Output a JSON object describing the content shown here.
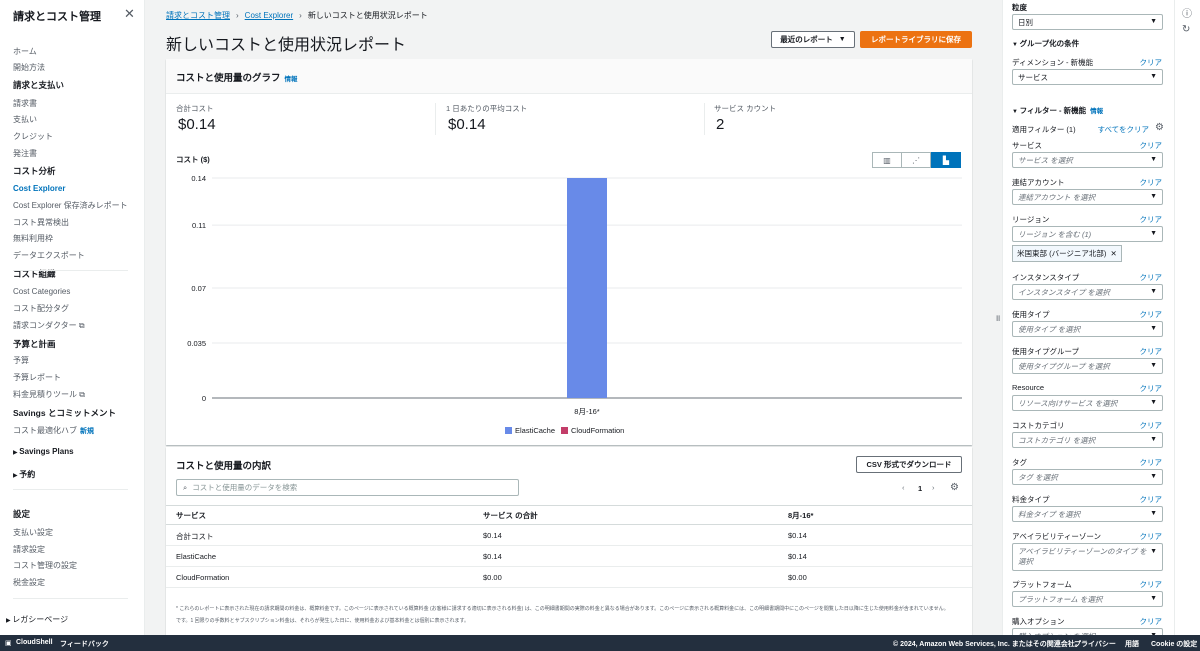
{
  "sidebar": {
    "title": "請求とコスト管理",
    "items": [
      {
        "label": "ホーム",
        "kind": "item"
      },
      {
        "label": "開始方法",
        "kind": "item"
      },
      {
        "label": "請求と支払い",
        "kind": "head"
      },
      {
        "label": "請求書",
        "kind": "item"
      },
      {
        "label": "支払い",
        "kind": "item"
      },
      {
        "label": "クレジット",
        "kind": "item"
      },
      {
        "label": "発注書",
        "kind": "item"
      },
      {
        "label": "コスト分析",
        "kind": "head"
      },
      {
        "label": "Cost Explorer",
        "kind": "active"
      },
      {
        "label": "Cost Explorer 保存済みレポート",
        "kind": "item"
      },
      {
        "label": "コスト異常検出",
        "kind": "item"
      },
      {
        "label": "無料利用枠",
        "kind": "item"
      },
      {
        "label": "データエクスポート",
        "kind": "item"
      },
      {
        "label": "コスト組織",
        "kind": "head"
      },
      {
        "label": "Cost Categories",
        "kind": "item"
      },
      {
        "label": "コスト配分タグ",
        "kind": "item"
      },
      {
        "label": "請求コンダクター",
        "kind": "item",
        "external": true
      },
      {
        "label": "予算と計画",
        "kind": "head"
      },
      {
        "label": "予算",
        "kind": "item"
      },
      {
        "label": "予算レポート",
        "kind": "item"
      },
      {
        "label": "料金見積りツール",
        "kind": "item",
        "external": true
      },
      {
        "label": "Savings とコミットメント",
        "kind": "head"
      },
      {
        "label": "コスト最適化ハブ",
        "kind": "item",
        "badge": "新規"
      },
      {
        "label": "Savings Plans",
        "kind": "group"
      },
      {
        "label": "予約",
        "kind": "group"
      },
      {
        "label": "設定",
        "kind": "head"
      },
      {
        "label": "支払い設定",
        "kind": "item"
      },
      {
        "label": "請求設定",
        "kind": "item"
      },
      {
        "label": "コスト管理の設定",
        "kind": "item"
      },
      {
        "label": "税金設定",
        "kind": "item"
      },
      {
        "label": "レガシーページ",
        "kind": "legacy"
      }
    ]
  },
  "breadcrumb": [
    "請求とコスト管理",
    "Cost Explorer",
    "新しいコストと使用状況レポート"
  ],
  "page_title": "新しいコストと使用状況レポート",
  "buttons": {
    "recent": "最近のレポート",
    "save": "レポートライブラリに保存",
    "csv": "CSV 形式でダウンロード"
  },
  "graph_panel": {
    "title": "コストと使用量のグラフ",
    "info": "情報",
    "kpis": [
      {
        "label": "合計コスト",
        "value": "$0.14"
      },
      {
        "label": "1 日あたりの平均コスト",
        "value": "$0.14"
      },
      {
        "label": "サービス カウント",
        "value": "2"
      }
    ]
  },
  "chart_data": {
    "type": "bar",
    "ylabel": "コスト ($)",
    "categories": [
      "8月-16*"
    ],
    "series": [
      {
        "name": "ElastiCache",
        "values": [
          0.14
        ],
        "color": "#688ae8"
      },
      {
        "name": "CloudFormation",
        "values": [
          0.0
        ],
        "color": "#c33d69"
      }
    ],
    "ylim": [
      0,
      0.14
    ],
    "yticks": [
      "0",
      "0.035",
      "0.07",
      "0.11",
      "0.14"
    ],
    "grid": true,
    "legend": "bottom"
  },
  "breakdown": {
    "title": "コストと使用量の内訳",
    "search_placeholder": "コストと使用量のデータを検索",
    "page": "1",
    "columns": [
      "サービス",
      "サービス の合計",
      "8月-16*"
    ],
    "rows": [
      [
        "合計コスト",
        "$0.14",
        "$0.14"
      ],
      [
        "ElastiCache",
        "$0.14",
        "$0.14"
      ],
      [
        "CloudFormation",
        "$0.00",
        "$0.00"
      ]
    ],
    "footnote1": "* これらのレポートに表示された現在の請求期間の料金は、概算料金です。このページに表示されている概算料金 (お客様に請求する適切に表示される料金) は、この明細書期間の実際の料金と異なる場合があります。このページに表示される概算料金には、この明細書期間中にこのページを閲覧した日以降に生じた使用料金が含まれていません。",
    "footnote2": "です。1 回限りの手数料とサブスクリプション料金は、それらが発生した日に、使用料金および基本料金とは個別に表示されます。"
  },
  "right": {
    "granularity_label": "粒度",
    "granularity_value": "日別",
    "group_title": "グループ化の条件",
    "dimension_label": "ディメンション - 新機能",
    "dimension_value": "サービス",
    "filter_title": "フィルター - 新機能",
    "filter_info": "情報",
    "applied": "適用フィルター (1)",
    "clear_all": "すべてをクリア",
    "clear": "クリア",
    "filters": [
      {
        "label": "サービス",
        "placeholder": "サービス を選択"
      },
      {
        "label": "連結アカウント",
        "placeholder": "連結アカウント を選択"
      },
      {
        "label": "リージョン",
        "placeholder": "リージョン を含む (1)",
        "token": "米国東部 (バージニア北部)"
      },
      {
        "label": "インスタンスタイプ",
        "placeholder": "インスタンスタイプ を選択"
      },
      {
        "label": "使用タイプ",
        "placeholder": "使用タイプ を選択"
      },
      {
        "label": "使用タイプグループ",
        "placeholder": "使用タイプグループ を選択"
      },
      {
        "label": "Resource",
        "placeholder": "リソース向けサービス を選択"
      },
      {
        "label": "コストカテゴリ",
        "placeholder": "コストカテゴリ を選択"
      },
      {
        "label": "タグ",
        "placeholder": "タグ を選択"
      },
      {
        "label": "料金タイプ",
        "placeholder": "料金タイプ を選択"
      },
      {
        "label": "アベイラビリティーゾーン",
        "placeholder": "アベイラビリティーゾーンのタイプ を選択"
      },
      {
        "label": "プラットフォーム",
        "placeholder": "プラットフォーム を選択"
      },
      {
        "label": "購入オプション",
        "placeholder": "購入オプション を選択"
      }
    ]
  },
  "bottom": {
    "cloudshell": "CloudShell",
    "feedback": "フィードバック",
    "copyright": "© 2024, Amazon Web Services, Inc. またはその関連会社。",
    "privacy": "プライバシー",
    "terms": "用語",
    "cookie": "Cookie の設定"
  },
  "colors": {
    "accent": "#ec7211",
    "link": "#0073bb",
    "bar": "#688ae8",
    "footer": "#232f3e"
  }
}
